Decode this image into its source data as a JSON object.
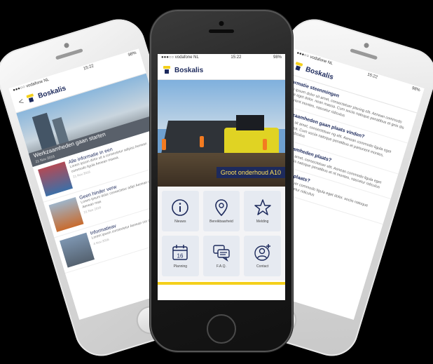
{
  "status": {
    "carrier": "●●●○○ vodafone NL",
    "time": "15:22",
    "battery": "98%"
  },
  "brand": {
    "name": "Boskalis"
  },
  "center": {
    "hero_caption": "Groot onderhoud A10",
    "tiles": [
      {
        "label": "Nieuws",
        "icon": "info-icon"
      },
      {
        "label": "Bereikbaarheid",
        "icon": "location-pin-icon"
      },
      {
        "label": "Melding",
        "icon": "star-icon"
      },
      {
        "label": "Planning",
        "icon": "calendar-icon"
      },
      {
        "label": "F.A.Q.",
        "icon": "chat-bubbles-icon"
      },
      {
        "label": "Contact",
        "icon": "add-contact-icon"
      }
    ],
    "calendar_day": "16"
  },
  "left": {
    "back": "<",
    "hero_caption": "Werkzaamheden gaan starten",
    "hero_date": "21 Nov 2016",
    "articles": [
      {
        "title": "Alle informatie in een",
        "body": "Lorem ipsum dolor sit a consectetur adipisc Aenean commodo ligula Aenean massa.",
        "date": "21 Nov 2016"
      },
      {
        "title": "Geen hinder verw",
        "body": "Lorem ipsum dolor consectetur adipi Aenean commodo dolor. Aenean mas",
        "date": "21 Nov 2016"
      },
      {
        "title": "Informatieav",
        "body": "Lorem ipsum consectetur Aenean cor dolor. Aenea",
        "date": "4 Nov 2016"
      }
    ]
  },
  "right": {
    "items": [
      {
        "q": "formatie steenmingen",
        "a": "rem ipsum dolor sit amet, consectetuer piscing elit. Aenean commodo ligula eget dolor. nean massa. Cum sociis natoque penatibus et gnis dis parturient montes, nascetur ridiculus"
      },
      {
        "q": "Werkzaamheden gaan plaats vinden?",
        "a": "um dolor sit amet, consectetuer ng elit. Aenean commodo ligula eget dolor. nassa. Cum sociis natoque penatibus et parturient montes, nascetur ridiculus"
      },
      {
        "q": "er werkzaamheden plaats?",
        "a": "ipsum dolor sit amet, consectetuer elit. Aenean commodo ligula eget dolor. Cum sociis natoque penatibus et nt montes, nascetur ridiculus"
      },
      {
        "q": "kzaamheden plaats?",
        "a": "sit amet, consectetuer commodo ligula eget dolor. sociis natoque penatibus et s, nascetur ridiculus"
      }
    ]
  }
}
